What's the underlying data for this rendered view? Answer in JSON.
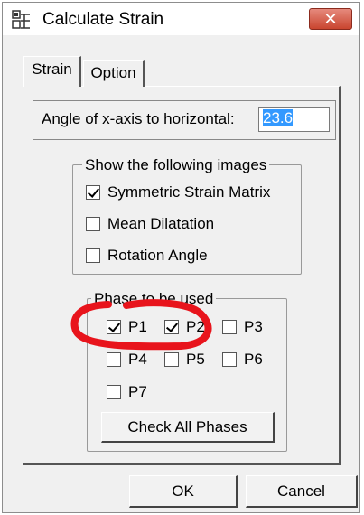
{
  "window": {
    "title": "Calculate Strain",
    "close_symbol": "✕"
  },
  "tabs": [
    {
      "label": "Strain",
      "selected": true
    },
    {
      "label": "Option",
      "selected": false
    }
  ],
  "angle": {
    "label": "Angle of x-axis to horizontal:",
    "value": "23.6"
  },
  "images_group": {
    "legend": "Show the following images",
    "items": [
      {
        "label": "Symmetric Strain Matrix",
        "checked": true
      },
      {
        "label": "Mean Dilatation",
        "checked": false
      },
      {
        "label": "Rotation Angle",
        "checked": false
      }
    ]
  },
  "phase_group": {
    "legend": "Phase to be used",
    "phases": [
      {
        "label": "P1",
        "checked": true
      },
      {
        "label": "P2",
        "checked": true
      },
      {
        "label": "P3",
        "checked": false
      },
      {
        "label": "P4",
        "checked": false
      },
      {
        "label": "P5",
        "checked": false
      },
      {
        "label": "P6",
        "checked": false
      },
      {
        "label": "P7",
        "checked": false
      }
    ],
    "check_all_label": "Check All Phases"
  },
  "buttons": {
    "ok": "OK",
    "cancel": "Cancel"
  },
  "annotation_color": "#e8141c"
}
